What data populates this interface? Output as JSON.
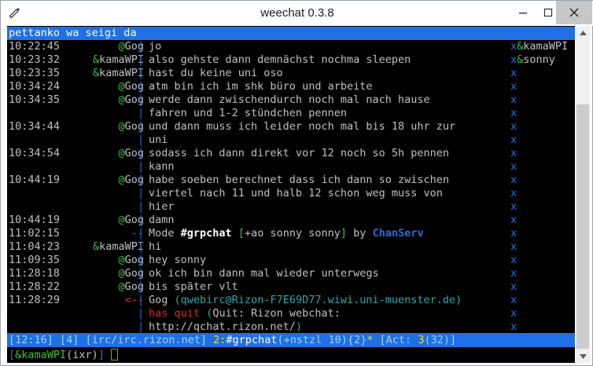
{
  "window": {
    "title": "weechat 0.3.8"
  },
  "topic": "pettanko wa seigi da",
  "messages": [
    {
      "time": "10:22:45",
      "prefix": "@",
      "nick": "Gog",
      "text": "jo"
    },
    {
      "time": "10:23:32",
      "prefix": "&",
      "nick": "kamaWPI",
      "text": "also gehste dann demnächst nochma sleepen"
    },
    {
      "time": "10:23:35",
      "prefix": "&",
      "nick": "kamaWPI",
      "text": "hast du keine uni oso"
    },
    {
      "time": "10:34:24",
      "prefix": "@",
      "nick": "Gog",
      "text": "atm bin ich im shk büro und arbeite"
    },
    {
      "time": "10:34:35",
      "prefix": "@",
      "nick": "Gog",
      "text": "werde dann zwischendurch noch mal nach hause"
    },
    {
      "time": "",
      "prefix": "",
      "nick": "",
      "text": "fahren und 1-2 stündchen pennen"
    },
    {
      "time": "10:34:44",
      "prefix": "@",
      "nick": "Gog",
      "text": "und dann muss ich leider noch mal bis 18 uhr zur"
    },
    {
      "time": "",
      "prefix": "",
      "nick": "",
      "text": "uni"
    },
    {
      "time": "10:34:54",
      "prefix": "@",
      "nick": "Gog",
      "text": "sodass ich dann direkt vor 12 noch so 5h pennen"
    },
    {
      "time": "",
      "prefix": "",
      "nick": "",
      "text": "kann"
    },
    {
      "time": "10:44:19",
      "prefix": "@",
      "nick": "Gog",
      "text": "habe soeben berechnet dass ich dann so zwischen"
    },
    {
      "time": "",
      "prefix": "",
      "nick": "",
      "text": "viertel nach 11 und halb 12 schon weg muss von"
    },
    {
      "time": "",
      "prefix": "",
      "nick": "",
      "text": "hier"
    },
    {
      "time": "10:44:19",
      "prefix": "@",
      "nick": "Gog",
      "text": "damn"
    }
  ],
  "mode_line": {
    "time": "11:02:15",
    "arrow": "--",
    "word": "Mode",
    "channel": "#grpchat",
    "open": "[",
    "modes": "+ao sonny sonny",
    "close": "]",
    "by": "by",
    "who": "ChanServ"
  },
  "messages2": [
    {
      "time": "11:04:23",
      "prefix": "&",
      "nick": "kamaWPI",
      "text": "hi"
    },
    {
      "time": "11:09:35",
      "prefix": "@",
      "nick": "Gog",
      "text": "hey sonny"
    },
    {
      "time": "11:28:18",
      "prefix": "@",
      "nick": "Gog",
      "text": "ok ich bin dann mal wieder unterwegs"
    },
    {
      "time": "11:28:22",
      "prefix": "@",
      "nick": "Gog",
      "text": "bis später vlt"
    }
  ],
  "quit_line": {
    "time": "11:28:29",
    "arrow": "<--",
    "nick": "Gog",
    "host": "(qwebirc@Rizon-F7E69D77.wiwi.uni-muenster.de)",
    "action": "has quit",
    "reason_open": "(",
    "reason_label": "Quit: Rizon webchat:",
    "reason_url": "http://qchat.rizon.net/",
    "reason_close": ")"
  },
  "nicklist": [
    {
      "prefix": "&",
      "nick": "kamaWPI"
    },
    {
      "prefix": "&",
      "nick": "sonny"
    }
  ],
  "nicklist_marker": "x",
  "status": {
    "time": "[12:16]",
    "buffer_count": "[4]",
    "server": "[irc/irc.rizon.net]",
    "buffer_num": "2:",
    "channel": "#grpchat",
    "modes": "(+nstzl 10)",
    "users": "{2}",
    "star": "*",
    "act_label": "[Act:",
    "act_num": "3",
    "act_count": "(32)",
    "act_close": "]"
  },
  "input": {
    "open": "[",
    "nick": "&kamaWPI",
    "mode": "(ixr)",
    "close": "]"
  },
  "colors": {
    "accent_blue": "#1f6fe6",
    "nick_green": "#39c239",
    "quit_red": "#e02929",
    "host_cyan": "#2aa9a9",
    "text_gray": "#c0c0c0",
    "status_yellow": "#f2e000"
  }
}
